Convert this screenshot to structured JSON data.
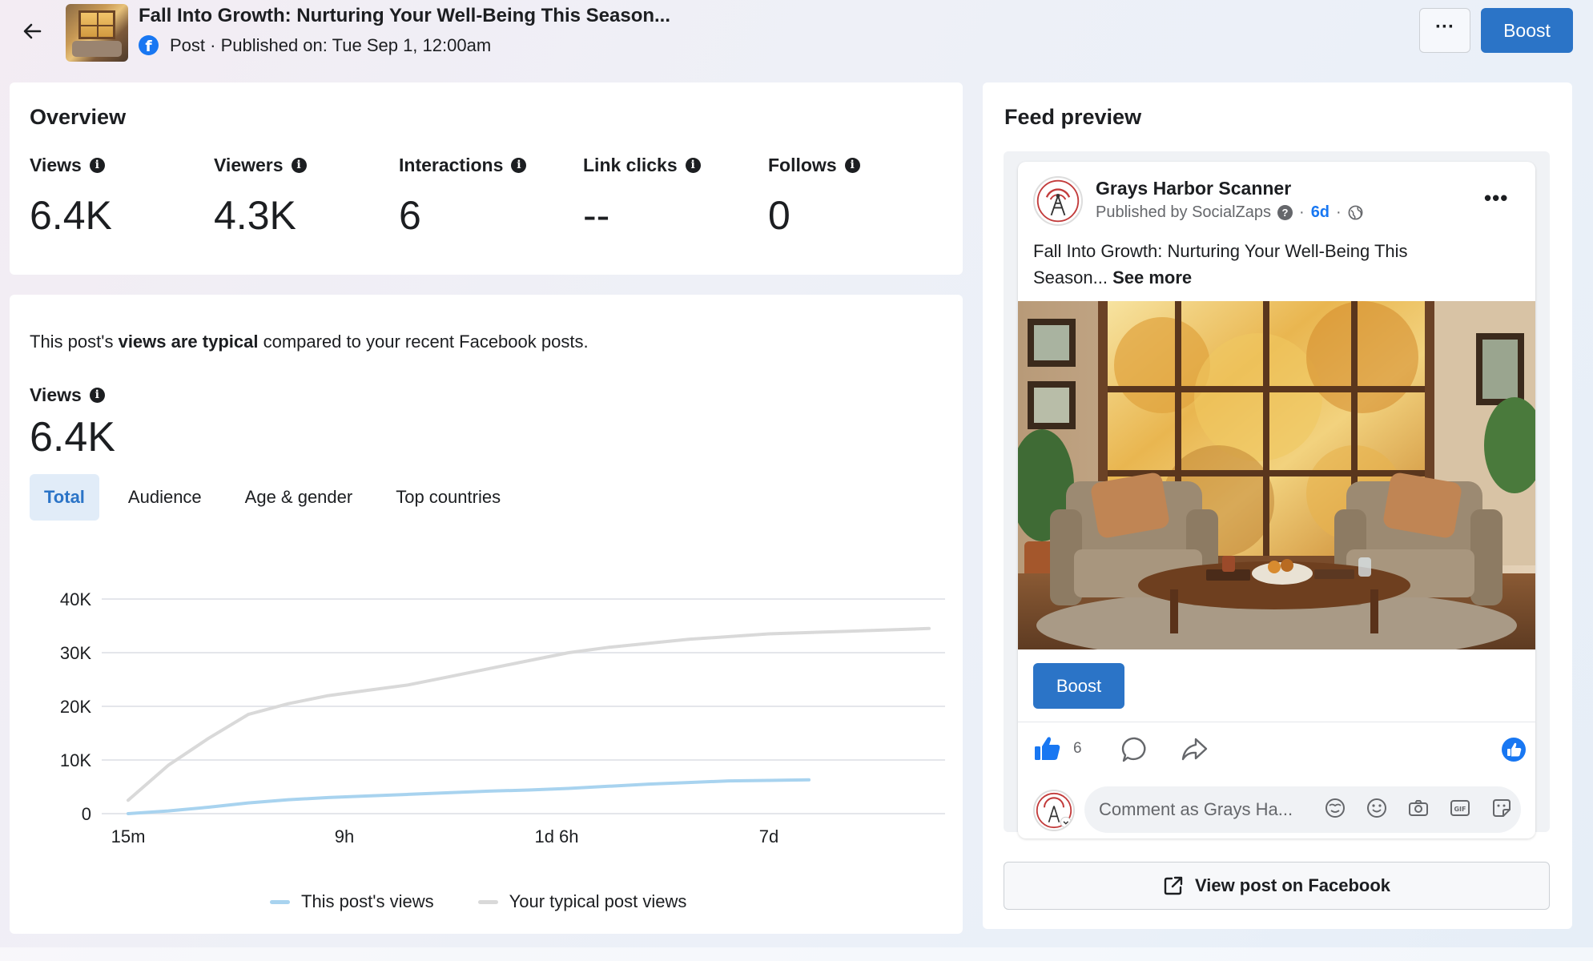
{
  "header": {
    "title": "Fall Into Growth: Nurturing Your Well-Being This Season...",
    "meta": "Post · Published on: Tue Sep 1, 12:00am",
    "more_label": "···",
    "boost_label": "Boost",
    "icons": {
      "back": "back-arrow-icon",
      "facebook": "facebook-icon"
    }
  },
  "overview": {
    "title": "Overview",
    "metrics": [
      {
        "label": "Views",
        "value": "6.4K"
      },
      {
        "label": "Viewers",
        "value": "4.3K"
      },
      {
        "label": "Interactions",
        "value": "6"
      },
      {
        "label": "Link clicks",
        "value": "--"
      },
      {
        "label": "Follows",
        "value": "0"
      }
    ]
  },
  "views_section": {
    "typical_prefix": "This post's ",
    "typical_bold": "views are typical",
    "typical_suffix": " compared to your recent Facebook posts.",
    "views_label": "Views",
    "views_value": "6.4K",
    "tabs": [
      {
        "label": "Total",
        "active": true
      },
      {
        "label": "Audience",
        "active": false
      },
      {
        "label": "Age & gender",
        "active": false
      },
      {
        "label": "Top countries",
        "active": false
      }
    ]
  },
  "chart_data": {
    "type": "line",
    "x_ticks": [
      "15m",
      "9h",
      "1d 6h",
      "7d"
    ],
    "y_ticks": [
      "40K",
      "30K",
      "20K",
      "10K",
      "0"
    ],
    "ylim": [
      0,
      40000
    ],
    "grid": true,
    "legend_placement": "bottom",
    "colors": {
      "this_post": "#a8d3ef",
      "typical": "#d9d9d9"
    },
    "series": [
      {
        "name": "This post's views",
        "color": "#a8d3ef",
        "points": [
          [
            0,
            0
          ],
          [
            0.05,
            500
          ],
          [
            0.1,
            1200
          ],
          [
            0.15,
            2000
          ],
          [
            0.2,
            2600
          ],
          [
            0.25,
            3000
          ],
          [
            0.3,
            3300
          ],
          [
            0.35,
            3600
          ],
          [
            0.4,
            3900
          ],
          [
            0.45,
            4200
          ],
          [
            0.5,
            4400
          ],
          [
            0.55,
            4700
          ],
          [
            0.6,
            5100
          ],
          [
            0.65,
            5500
          ],
          [
            0.7,
            5800
          ],
          [
            0.75,
            6100
          ],
          [
            0.8,
            6200
          ],
          [
            0.85,
            6300
          ]
        ]
      },
      {
        "name": "Your typical post views",
        "color": "#d9d9d9",
        "points": [
          [
            0,
            2500
          ],
          [
            0.05,
            9000
          ],
          [
            0.1,
            14000
          ],
          [
            0.15,
            18500
          ],
          [
            0.2,
            20500
          ],
          [
            0.25,
            22000
          ],
          [
            0.3,
            23000
          ],
          [
            0.35,
            24000
          ],
          [
            0.4,
            25500
          ],
          [
            0.45,
            27000
          ],
          [
            0.5,
            28500
          ],
          [
            0.55,
            30000
          ],
          [
            0.6,
            31000
          ],
          [
            0.7,
            32500
          ],
          [
            0.8,
            33500
          ],
          [
            0.9,
            34000
          ],
          [
            1.0,
            34500
          ]
        ]
      }
    ]
  },
  "feed_preview": {
    "title": "Feed preview",
    "page_name": "Grays Harbor Scanner",
    "published_by": "Published by SocialZaps",
    "age": "6d",
    "post_text": "Fall Into Growth: Nurturing Your Well-Being This Season...",
    "see_more": "See more",
    "boost_label": "Boost",
    "like_count": "6",
    "comment_placeholder": "Comment as Grays Ha...",
    "view_on_facebook": "View post on Facebook",
    "icons": [
      "like-icon",
      "comment-icon",
      "share-icon",
      "avatar-icon",
      "sticker-icon",
      "emoji-icon",
      "camera-icon",
      "gif-icon",
      "face-sticker-icon",
      "external-link-icon",
      "globe-icon",
      "question-icon"
    ]
  }
}
